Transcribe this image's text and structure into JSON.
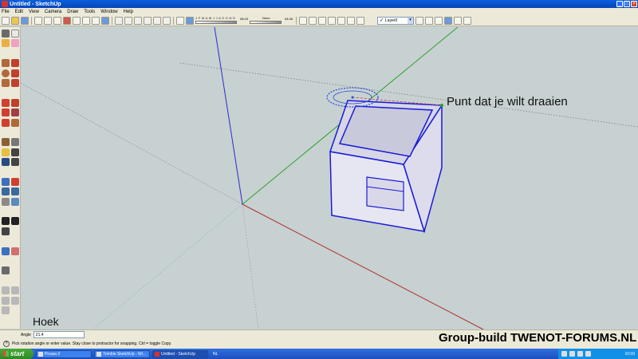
{
  "window": {
    "title": "Untitled - SketchUp",
    "controls": [
      "minimize-icon",
      "maximize-icon",
      "close-icon"
    ]
  },
  "menu": [
    "File",
    "Edit",
    "View",
    "Camera",
    "Draw",
    "Tools",
    "Window",
    "Help"
  ],
  "toolbar": {
    "shadow_months": "J F M A M J J A S O N D",
    "shadow_date_value": "08:43",
    "shadow_time_label": "Noon",
    "shadow_time_value": "04:46",
    "layer": "Layer0"
  },
  "viewport": {
    "annotation": "Punt dat je wilt draaien",
    "corner_label": "Hoek",
    "colors": {
      "background": "#c7d1d1",
      "red_axis": "#b03030",
      "green_axis": "#2ea02e",
      "blue_axis": "#2a2ad0",
      "selection": "#1a1ad8",
      "box_face": "#e8e8f4",
      "protractor": "#2a4ad8"
    }
  },
  "measurements": {
    "label": "Angle",
    "value": "21.4"
  },
  "status": {
    "hint": "Pick rotation angle or enter value.  Stay close to protractor for snapping. Ctrl = toggle Copy."
  },
  "watermark": "Group-build TWENOT-FORUMS.NL",
  "taskbar": {
    "start_label": "start",
    "tasks": [
      {
        "label": "Picasa 3",
        "active": false
      },
      {
        "label": "Trimble SketchUp - Wi...",
        "active": false
      },
      {
        "label": "Untitled - SketchUp",
        "active": true
      }
    ],
    "language": "NL",
    "clock": "10:09"
  }
}
